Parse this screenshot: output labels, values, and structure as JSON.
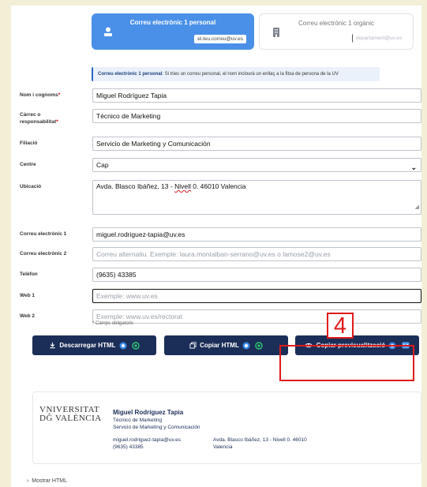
{
  "options": [
    {
      "title": "Correu electrònic 1 personal",
      "chip": "el.teu.correu@uv.es",
      "icon": "person-icon",
      "selected": true
    },
    {
      "title": "Correu electrònic 1 orgànic",
      "chip": "departament@uv.es",
      "icon": "building-icon",
      "selected": false
    }
  ],
  "info": {
    "bold": "Correu electrònic 1 personal",
    "text": ": Si tries un correu personal, el nom inclourà un enllaç a la fitxa de persona de la UV"
  },
  "form": {
    "name": {
      "label": "Nom i cognoms",
      "required": "*",
      "value": "Miguel Rodríguez Tapia"
    },
    "position": {
      "label1": "Càrrec o",
      "label2": "responsabilitat",
      "required": "*",
      "value": "Técnico de Marketing"
    },
    "affiliation": {
      "label": "Filiació",
      "value": "Servicio de Marketing y Comunicación"
    },
    "center": {
      "label": "Centre",
      "value": "Cap"
    },
    "location": {
      "label": "Ubicació",
      "value_before": "Avda. Blasco Ibáñez, 13 - ",
      "value_spell": "Nivell",
      "value_after": " 0. 46010 Valencia"
    },
    "email1": {
      "label": "Correu electrònic 1",
      "value": "miguel.rodriguez-tapia@uv.es"
    },
    "email2": {
      "label": "Correu electrònic 2",
      "placeholder": "Correu alternatiu. Exemple: laura.montalban-serrano@uv.es o lamose2@uv.es"
    },
    "phone": {
      "label": "Telèfon",
      "value": "(9635) 43385"
    },
    "web1": {
      "label": "Web 1",
      "placeholder": "Exemple: www.uv.es"
    },
    "web2": {
      "label": "Web 2",
      "placeholder": "Exemple: www.uv.es/rectorat"
    },
    "required_note": "* Camps obligatoris"
  },
  "buttons": {
    "download": "Descarregar HTML",
    "copy": "Copiar HTML",
    "preview": "Copiar previsualització"
  },
  "annotation": {
    "number": "4",
    "color": "#e01a1a"
  },
  "signature": {
    "logo_line1": "VNIVERSITAT",
    "logo_line2": "DĞ VALÈNCIA",
    "name": "Miguel Rodríguez Tapia",
    "position": "Técnico de Marketing",
    "affiliation": "Servicio de Marketing y Comunicación",
    "email": "miguel.rodriguez-tapia@uv.es",
    "phone": "(9635) 43385",
    "address1": "Avda. Blasco Ibáñez, 13 - Nivell 0. 46010",
    "address2": "Valencia"
  },
  "show_html": "Mostrar HTML",
  "colors": {
    "accent": "#4a90e8",
    "navy": "#1b2e57",
    "background": "#f3efd7"
  }
}
